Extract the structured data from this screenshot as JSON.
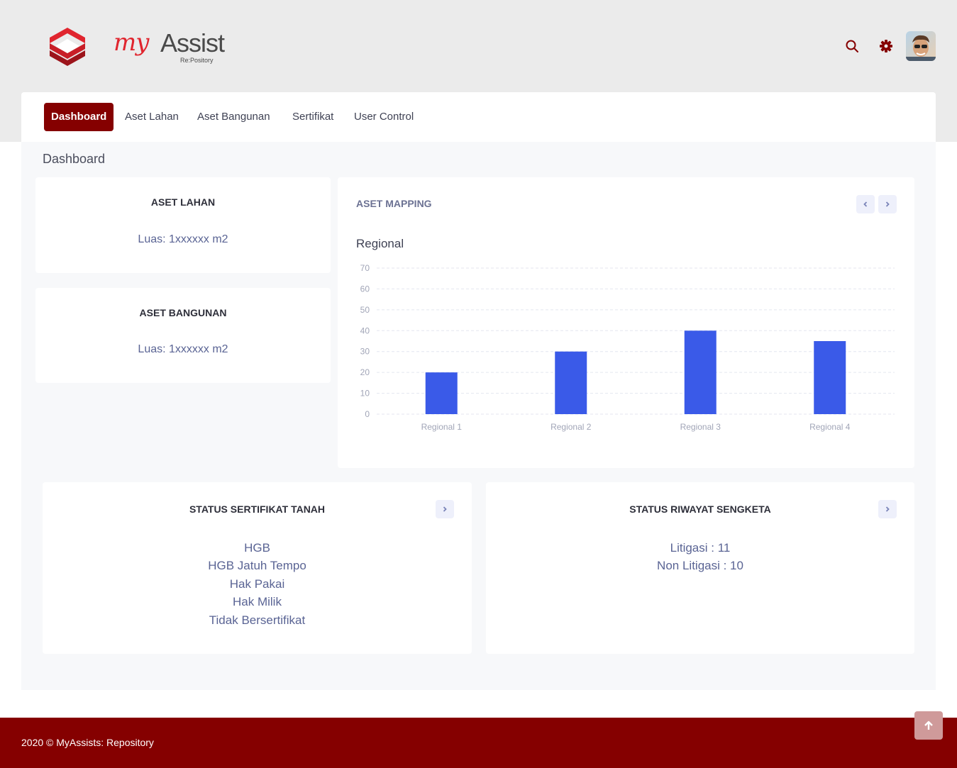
{
  "header": {
    "brand_my": "my",
    "brand_assist": "Assist",
    "brand_sub": "Re:Pository",
    "icons": [
      "search-icon",
      "gear-icon"
    ],
    "accent_color": "#850000"
  },
  "nav": {
    "items": [
      {
        "label": "Dashboard",
        "active": true
      },
      {
        "label": "Aset Lahan",
        "active": false
      },
      {
        "label": "Aset Bangunan",
        "active": false
      },
      {
        "label": "Sertifikat",
        "active": false
      },
      {
        "label": "User Control",
        "active": false
      }
    ]
  },
  "page": {
    "title": "Dashboard"
  },
  "cards": {
    "aset_lahan": {
      "title": "ASET LAHAN",
      "value": "Luas: 1xxxxxx m2"
    },
    "aset_bangunan": {
      "title": "ASET BANGUNAN",
      "value": "Luas: 1xxxxxx m2"
    },
    "aset_mapping": {
      "title": "ASET MAPPING"
    },
    "status_sertifikat": {
      "title": "STATUS SERTIFIKAT TANAH",
      "items": [
        "HGB",
        "HGB Jatuh Tempo",
        "Hak Pakai",
        "Hak Milik",
        "Tidak Bersertifikat"
      ]
    },
    "status_sengketa": {
      "title": "STATUS RIWAYAT SENGKETA",
      "items": [
        "Litigasi : 11",
        "Non Litigasi : 10"
      ]
    }
  },
  "chart_data": {
    "type": "bar",
    "title": "Regional",
    "categories": [
      "Regional 1",
      "Regional 2",
      "Regional 3",
      "Regional 4"
    ],
    "values": [
      20,
      30,
      40,
      35
    ],
    "ylim": [
      0,
      70
    ],
    "yticks": [
      0,
      10,
      20,
      30,
      40,
      50,
      60,
      70
    ],
    "xlabel": "",
    "ylabel": "",
    "grid": true,
    "bar_color": "#3a5ae8"
  },
  "footer": {
    "text": "2020 © MyAssists: Repository"
  }
}
